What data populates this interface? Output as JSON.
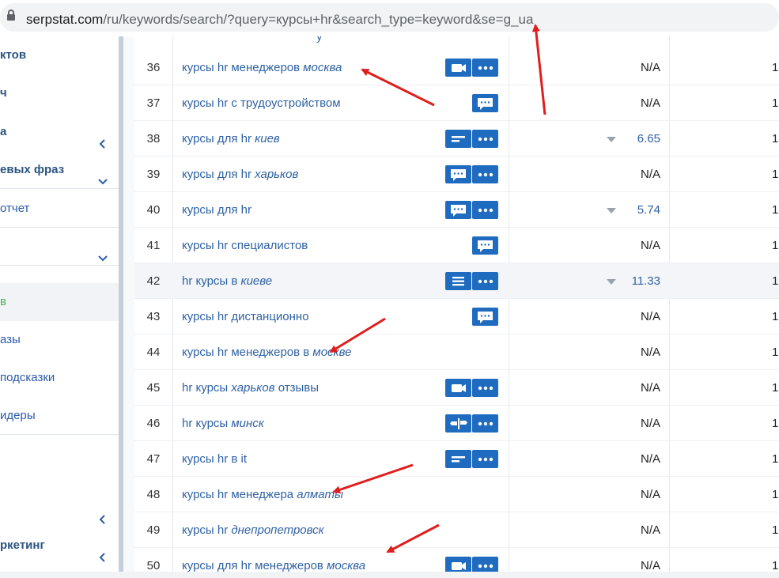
{
  "browser": {
    "url_host": "serpstat.com",
    "url_rest": "/ru/keywords/search/?query=курсы+hr&search_type=keyword&se=g_ua"
  },
  "sidebar": {
    "items": [
      {
        "label": "ктов",
        "bold": true
      },
      {
        "label": "ч",
        "bold": true
      },
      {
        "label": "а",
        "bold": true,
        "chevron": "chevron-left-icon"
      },
      {
        "label": "евых фраз",
        "bold": true,
        "chevron": "chevron-down-icon"
      },
      {
        "label": "отчет"
      },
      {
        "label": "",
        "chevron": "chevron-down-icon"
      },
      {
        "label": "в",
        "active": true
      },
      {
        "label": "азы"
      },
      {
        "label": "подсказки"
      },
      {
        "label": "идеры"
      },
      {
        "label": "",
        "chevron": "chevron-left-icon"
      },
      {
        "label": "ркетинг",
        "bold": true,
        "chevron": "chevron-left-icon"
      }
    ]
  },
  "table": {
    "top_fragment": "у",
    "rows": [
      {
        "num": "36",
        "kw_plain": "курсы hr менеджеров ",
        "kw_italic": "москва",
        "kw_after": "",
        "buttons": [
          "video",
          "more"
        ],
        "value": "N/A",
        "last": "1"
      },
      {
        "num": "37",
        "kw_plain": "курсы hr с трудоустройством",
        "kw_italic": "",
        "kw_after": "",
        "buttons": [
          "chat"
        ],
        "value": "N/A",
        "last": "1"
      },
      {
        "num": "38",
        "kw_plain": "курсы для hr ",
        "kw_italic": "киев",
        "kw_after": "",
        "buttons": [
          "snippet",
          "more"
        ],
        "value": "6.65",
        "trend": true,
        "last": "1"
      },
      {
        "num": "39",
        "kw_plain": "курсы для hr ",
        "kw_italic": "харьков",
        "kw_after": "",
        "buttons": [
          "chat",
          "more"
        ],
        "value": "N/A",
        "last": "1"
      },
      {
        "num": "40",
        "kw_plain": "курсы для hr",
        "kw_italic": "",
        "kw_after": "",
        "buttons": [
          "chat",
          "more"
        ],
        "value": "5.74",
        "trend": true,
        "last": "1"
      },
      {
        "num": "41",
        "kw_plain": "курсы hr специалистов",
        "kw_italic": "",
        "kw_after": "",
        "buttons": [
          "chat"
        ],
        "value": "N/A",
        "last": "1"
      },
      {
        "num": "42",
        "kw_plain": "hr курсы в ",
        "kw_italic": "киеве",
        "kw_after": "",
        "buttons": [
          "list",
          "more"
        ],
        "value": "11.33",
        "trend": true,
        "highlight": true,
        "last": "1"
      },
      {
        "num": "43",
        "kw_plain": "курсы hr дистанционно",
        "kw_italic": "",
        "kw_after": "",
        "buttons": [
          "chat"
        ],
        "value": "N/A",
        "last": "1"
      },
      {
        "num": "44",
        "kw_plain": "курсы hr менеджеров в ",
        "kw_italic": "москве",
        "kw_after": "",
        "buttons": [],
        "value": "N/A",
        "last": "1"
      },
      {
        "num": "45",
        "kw_plain": "hr курсы ",
        "kw_italic": "харьков",
        "kw_after": " отзывы",
        "buttons": [
          "video",
          "more"
        ],
        "value": "N/A",
        "last": "1"
      },
      {
        "num": "46",
        "kw_plain": "hr курсы ",
        "kw_italic": "минск",
        "kw_after": "",
        "buttons": [
          "sign",
          "more"
        ],
        "value": "N/A",
        "last": "1"
      },
      {
        "num": "47",
        "kw_plain": "курсы hr в it",
        "kw_italic": "",
        "kw_after": "",
        "buttons": [
          "snippet",
          "more"
        ],
        "value": "N/A",
        "last": "1"
      },
      {
        "num": "48",
        "kw_plain": "курсы hr менеджера ",
        "kw_italic": "алматы",
        "kw_after": "",
        "buttons": [],
        "value": "N/A",
        "last": "1"
      },
      {
        "num": "49",
        "kw_plain": "курсы hr ",
        "kw_italic": "днепропетровск",
        "kw_after": "",
        "buttons": [],
        "value": "N/A",
        "last": "1"
      },
      {
        "num": "50",
        "kw_plain": "курсы для hr менеджеров ",
        "kw_italic": "москва",
        "kw_after": "",
        "buttons": [
          "video",
          "more"
        ],
        "value": "N/A",
        "last": "1"
      }
    ]
  },
  "colors": {
    "accent": "#1f6bbf",
    "link": "#2f62a3",
    "arrow": "#e01e1e",
    "active_green": "#4caf50"
  }
}
